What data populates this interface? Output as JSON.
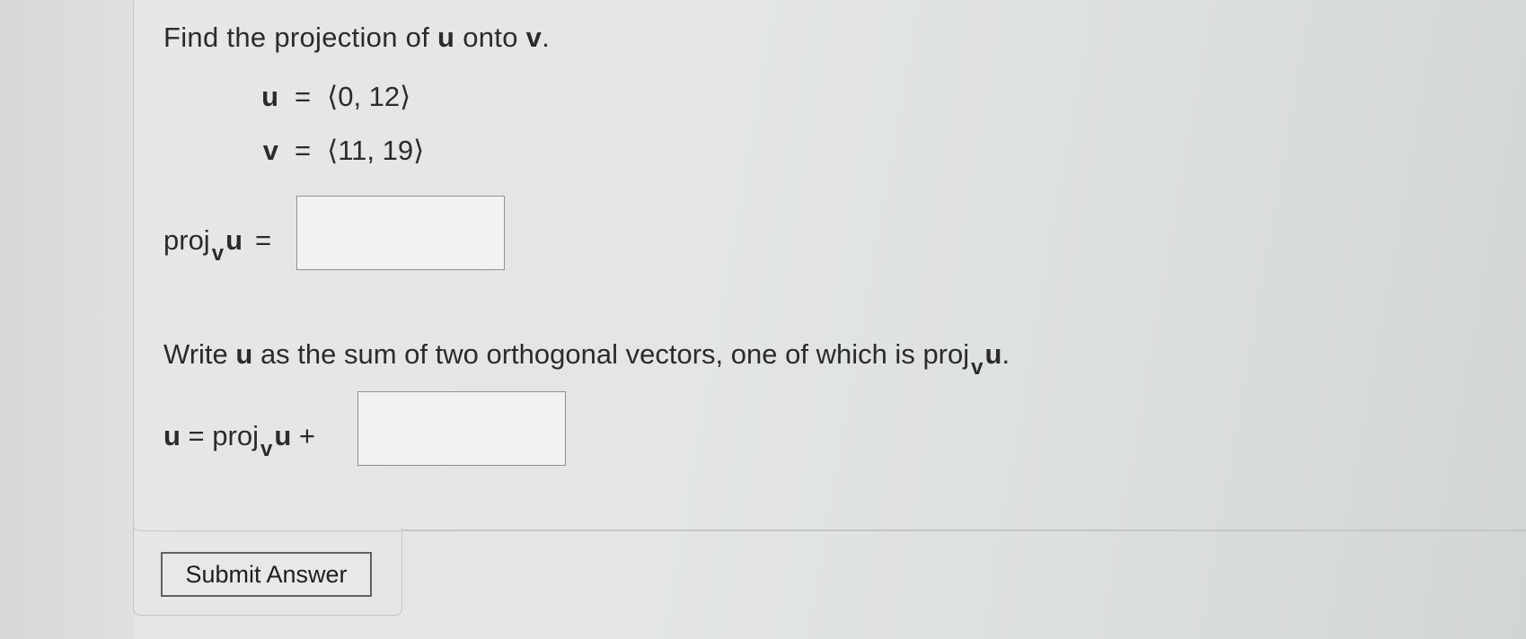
{
  "question": {
    "prefix": "Find the projection of ",
    "u_symbol": "u",
    "middle": " onto ",
    "v_symbol": "v",
    "suffix": "."
  },
  "vectors": {
    "u": {
      "name": "u",
      "equals": "=",
      "value": "⟨0, 12⟩"
    },
    "v": {
      "name": "v",
      "equals": "=",
      "value": "⟨11, 19⟩"
    }
  },
  "projection": {
    "proj_text": "proj",
    "subscript": "v",
    "u_symbol": "u",
    "equals": "=",
    "answer_value": ""
  },
  "orthogonal": {
    "prefix": "Write ",
    "u_symbol": "u",
    "middle": " as the sum of two orthogonal vectors, one of which is ",
    "proj_text": "proj",
    "subscript": "v",
    "u_symbol_end": "u",
    "suffix": "."
  },
  "sum_equation": {
    "u_symbol": "u",
    "equals": " = ",
    "proj_text": "proj",
    "subscript": "v",
    "u_symbol_2": "u",
    "plus": " +",
    "answer_value": ""
  },
  "submit": {
    "label": "Submit Answer"
  }
}
